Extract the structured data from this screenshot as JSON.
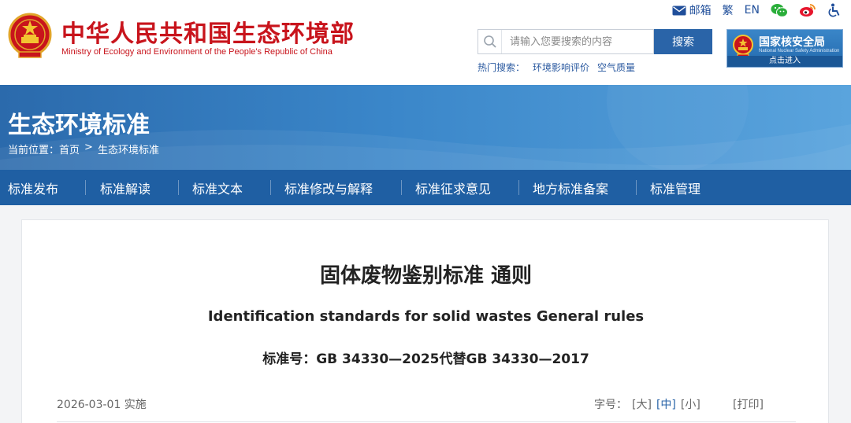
{
  "header": {
    "title_cn": "中华人民共和国生态环境部",
    "title_en": "Ministry of Ecology and Environment of the People's Republic of China",
    "top_links": {
      "mail": "邮箱",
      "traditional": "繁",
      "english": "EN"
    },
    "search": {
      "placeholder": "请输入您要搜索的内容",
      "button": "搜索"
    },
    "hot_search": {
      "label": "热门搜索：",
      "items": [
        "环境影响评价",
        "空气质量"
      ]
    },
    "nnsa": {
      "title": "国家核安全局",
      "subtitle": "National Nuclear Safety Administration",
      "enter": "点击进入"
    }
  },
  "banner": {
    "title": "生态环境标准",
    "breadcrumb": {
      "prefix": "当前位置：",
      "home": "首页",
      "separator": ">",
      "current": "生态环境标准"
    }
  },
  "nav": {
    "items": [
      "标准发布",
      "标准解读",
      "标准文本",
      "标准修改与解释",
      "标准征求意见",
      "地方标准备案",
      "标准管理"
    ]
  },
  "document": {
    "title_cn": "固体废物鉴别标准 通则",
    "title_en": "Identification standards for solid wastes General rules",
    "number": "标准号：GB 34330—2025代替GB 34330—2017",
    "effective_date": "2026-03-01 实施",
    "font_size": {
      "label": "字号：",
      "large": "[大]",
      "medium": "[中]",
      "small": "[小]"
    },
    "print": "[打印]"
  },
  "colors": {
    "brand_red": "#c8141c",
    "nav_blue": "#1f5fa3",
    "link_blue": "#2a64a8"
  }
}
